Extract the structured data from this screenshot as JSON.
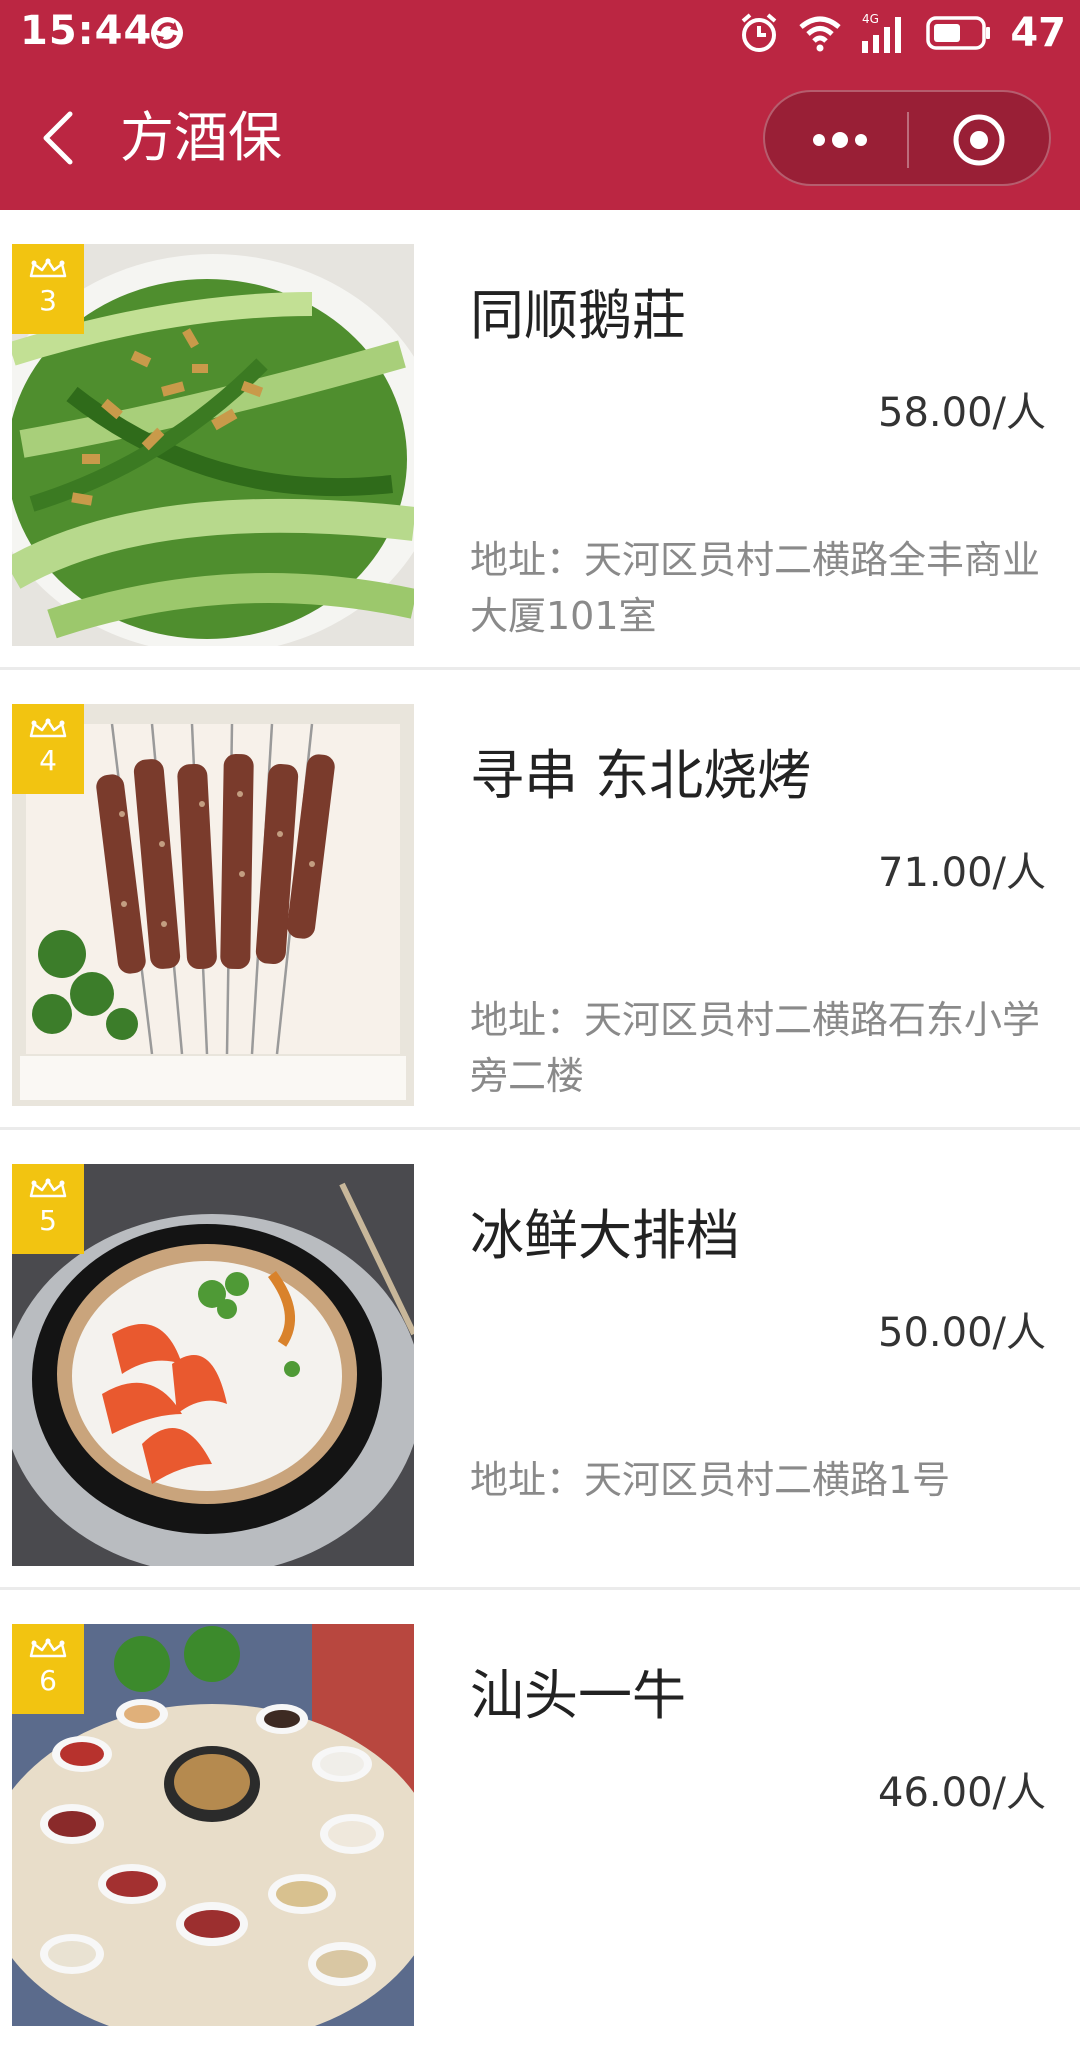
{
  "status_bar": {
    "time": "15:44",
    "network": "4G",
    "battery": "47"
  },
  "nav": {
    "title": "方酒保"
  },
  "restaurants": [
    {
      "rank": "3",
      "name": "同顺鹅莊",
      "price": "58.00/人",
      "address": "地址：天河区员村二横路全丰商业大厦101室",
      "image": "stir-fried-greens-photo"
    },
    {
      "rank": "4",
      "name": "寻串 东北烧烤",
      "price": "71.00/人",
      "address": "地址：天河区员村二横路石东小学旁二楼",
      "image": "meat-skewers-photo"
    },
    {
      "rank": "5",
      "name": "冰鲜大排档",
      "price": "50.00/人",
      "address": "地址：天河区员村二横路1号",
      "image": "shrimp-congee-photo"
    },
    {
      "rank": "6",
      "name": "汕头一牛",
      "price": "46.00/人",
      "address": "",
      "image": "beef-hotpot-photo"
    }
  ],
  "colors": {
    "brand_red": "#bb2642",
    "badge_yellow": "#f2c411",
    "address_gray": "#8a8a8a",
    "divider": "#ebebeb"
  }
}
